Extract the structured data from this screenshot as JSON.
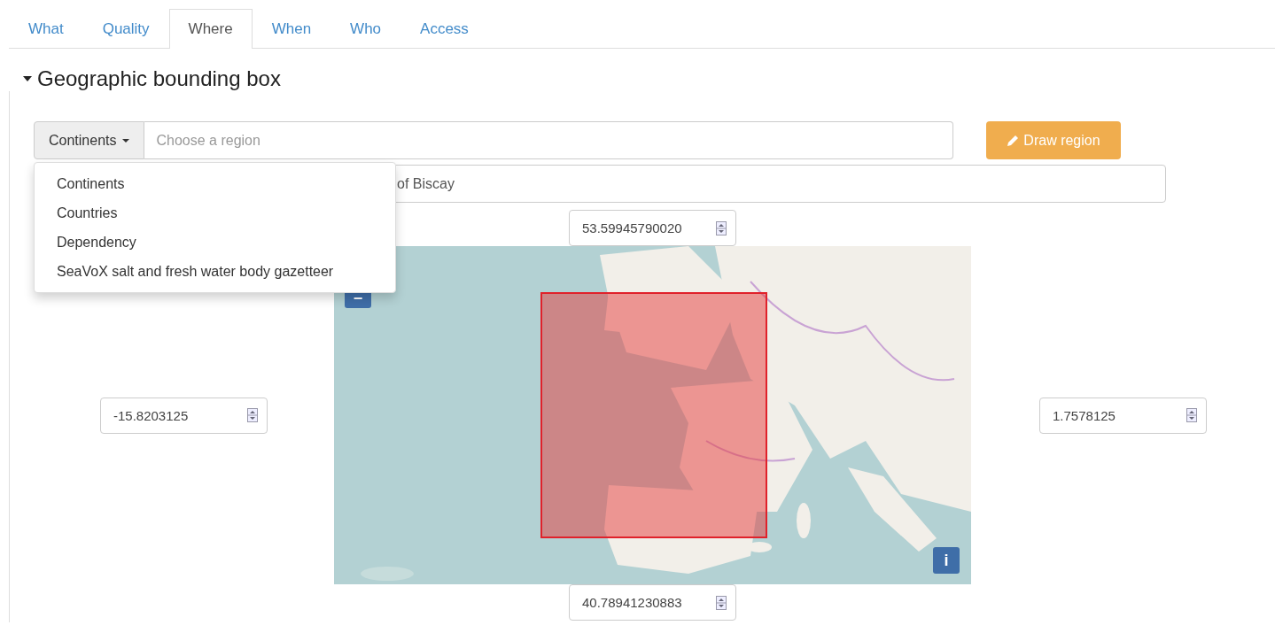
{
  "tabs": [
    {
      "label": "What",
      "selected": false
    },
    {
      "label": "Quality",
      "selected": false
    },
    {
      "label": "Where",
      "selected": true
    },
    {
      "label": "When",
      "selected": false
    },
    {
      "label": "Who",
      "selected": false
    },
    {
      "label": "Access",
      "selected": false
    }
  ],
  "section": {
    "title": "Geographic bounding box",
    "expanded": true
  },
  "region_picker": {
    "dropdown": "Continents",
    "placeholder": "Choose a region",
    "draw_button": "Draw region",
    "menu_open": true,
    "menu": [
      "Continents",
      "Countries",
      "Dependency",
      "SeaVoX salt and fresh water body gazetteer"
    ]
  },
  "selected_region": {
    "value": "of Biscay"
  },
  "bounds": {
    "north": "53.59945790020",
    "west": "-15.8203125",
    "east": "1.7578125",
    "south": "40.78941230883"
  },
  "map": {
    "kind": "picture",
    "zoom_out": "−",
    "info": "i"
  }
}
